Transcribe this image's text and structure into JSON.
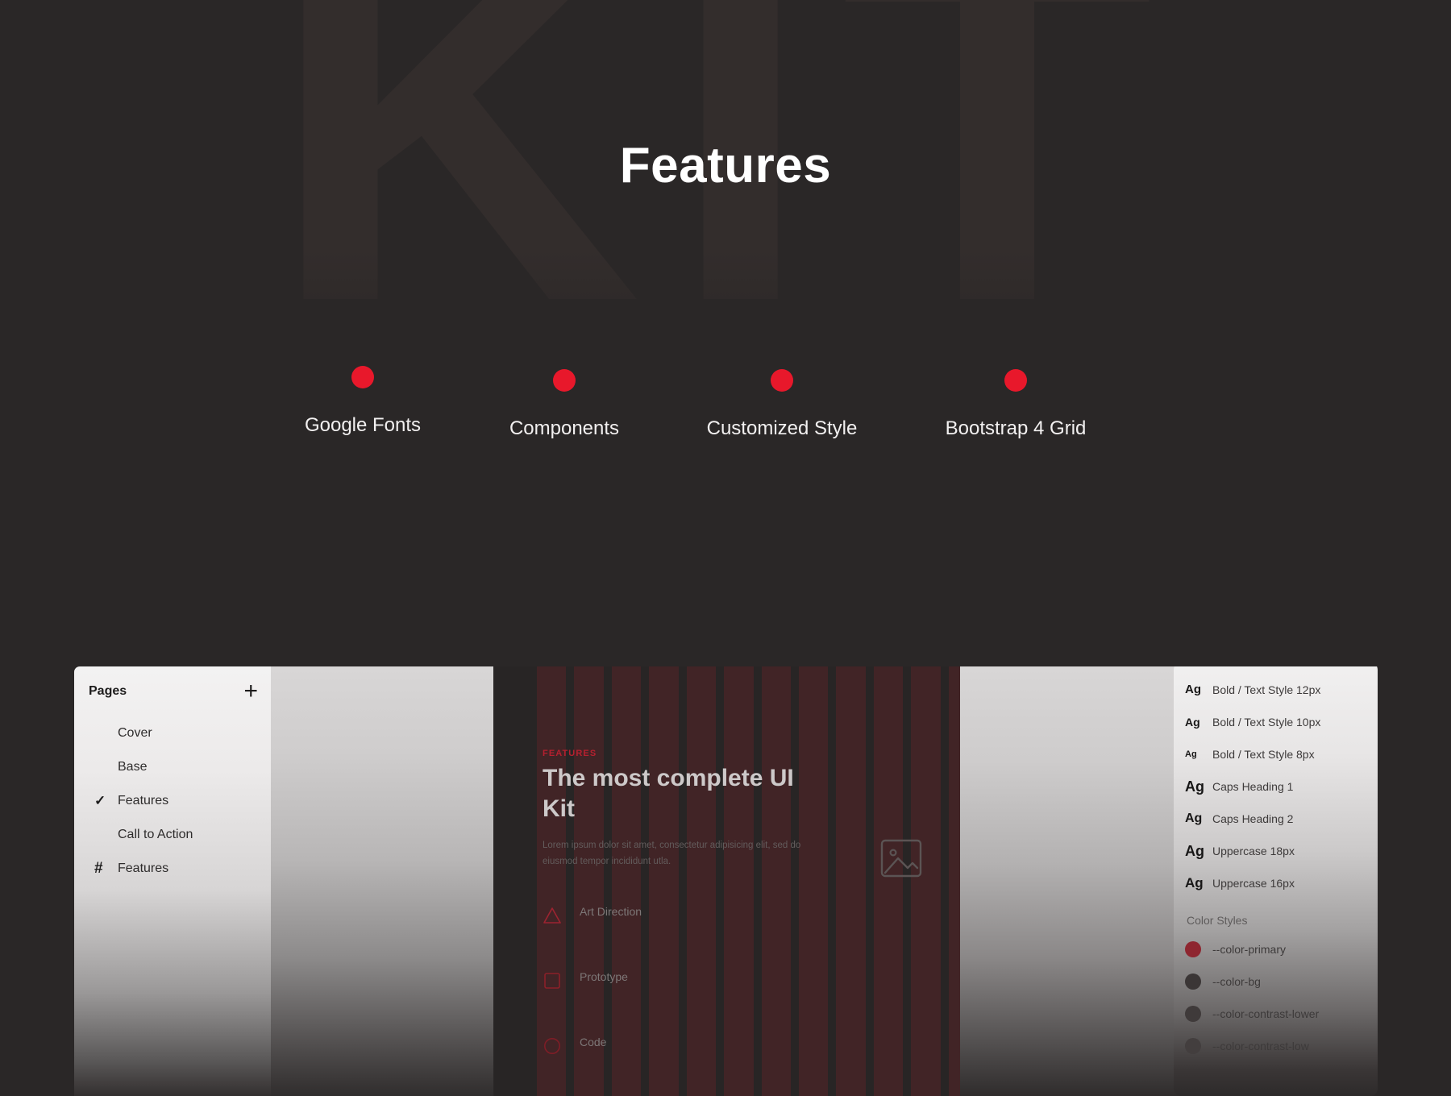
{
  "page": {
    "background_color": "#2a2727",
    "accent_color": "#e8182b",
    "watermark_text": "KIT"
  },
  "hero": {
    "title": "Features"
  },
  "features": [
    {
      "label": "Google Fonts",
      "dot_color": "#e8182b"
    },
    {
      "label": "Components",
      "dot_color": "#e8182b"
    },
    {
      "label": "Customized Style",
      "dot_color": "#e8182b"
    },
    {
      "label": "Bootstrap 4 Grid",
      "dot_color": "#e8182b"
    }
  ],
  "pages_panel": {
    "title": "Pages",
    "add_label": "+",
    "items": [
      {
        "label": "Cover",
        "mark": ""
      },
      {
        "label": "Base",
        "mark": ""
      },
      {
        "label": "Features",
        "mark": "✓"
      },
      {
        "label": "Call to Action",
        "mark": ""
      },
      {
        "label": "Features",
        "mark": "#"
      }
    ]
  },
  "artboard": {
    "eyebrow": "FEATURES",
    "heading": "The most complete UI Kit",
    "paragraph": "Lorem ipsum dolor sit amet, consectetur adipisicing elit, sed do eiusmod tempor incididunt utla.",
    "feature_items": [
      {
        "label": "Art Direction",
        "icon": "triangle-icon"
      },
      {
        "label": "Prototype",
        "icon": "square-icon"
      },
      {
        "label": "Code",
        "icon": "circle-icon"
      }
    ],
    "image_placeholder_icon": "image-icon"
  },
  "styles_panel": {
    "text_styles": [
      {
        "preview": "Ag",
        "label": "Bold / Text Style 12px",
        "size_class": "ag-12"
      },
      {
        "preview": "Ag",
        "label": "Bold / Text Style 10px",
        "size_class": "ag-10"
      },
      {
        "preview": "Ag",
        "label": "Bold / Text Style 8px",
        "size_class": "ag-8"
      },
      {
        "preview": "Ag",
        "label": "Caps Heading 1",
        "size_class": "ag-c1"
      },
      {
        "preview": "Ag",
        "label": "Caps Heading 2",
        "size_class": "ag-c2"
      },
      {
        "preview": "Ag",
        "label": "Uppercase 18px",
        "size_class": "ag-u18"
      },
      {
        "preview": "Ag",
        "label": "Uppercase 16px",
        "size_class": "ag-u16"
      }
    ],
    "section_title": "Color Styles",
    "color_styles": [
      {
        "label": "--color-primary",
        "color": "#8e2630"
      },
      {
        "label": "--color-bg",
        "color": "#332f2f"
      },
      {
        "label": "--color-contrast-lower",
        "color": "#3c3838"
      },
      {
        "label": "--color-contrast-low",
        "color": "#454040"
      }
    ]
  }
}
